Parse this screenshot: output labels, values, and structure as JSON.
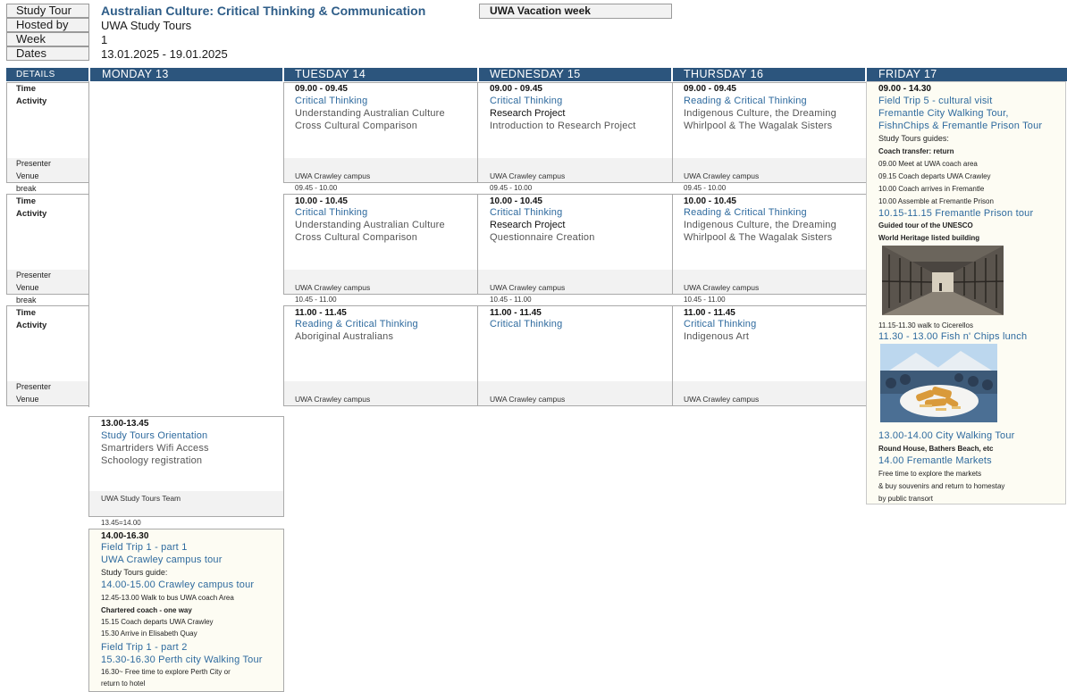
{
  "header": {
    "labels": [
      "Study Tour",
      "Hosted by",
      "Week",
      "Dates"
    ],
    "course_title": "Australian Culture: Critical Thinking & Communication",
    "hosted_by": "UWA Study Tours",
    "week": "1",
    "dates": "13.01.2025 - 19.01.2025",
    "vacation": "UWA Vacation week"
  },
  "days": [
    "DETAILS",
    "MONDAY 13",
    "TUESDAY 14",
    "WEDNESDAY 15",
    "THURSDAY 16",
    "FRIDAY 17"
  ],
  "details": {
    "time": "Time",
    "activity": "Activity",
    "presenter": "Presenter",
    "venue": "Venue",
    "break": "break"
  },
  "sessions": {
    "s1": {
      "tue": {
        "time": "09.00 - 09.45",
        "title": "Critical Thinking",
        "l1": "Understanding Australian Culture",
        "l2": "Cross Cultural Comparison",
        "venue": "UWA Crawley campus",
        "break": "09.45 - 10.00"
      },
      "wed": {
        "time": "09.00 - 09.45",
        "title": "Critical Thinking",
        "l1": "Research Project",
        "l2": "Introduction to Research Project",
        "venue": "UWA Crawley campus",
        "break": "09.45 - 10.00"
      },
      "thu": {
        "time": "09.00 - 09.45",
        "title": "Reading & Critical Thinking",
        "l1": "Indigenous Culture, the Dreaming",
        "l2": "Whirlpool & The Wagalak Sisters",
        "venue": "UWA Crawley campus",
        "break": "09.45 - 10.00"
      }
    },
    "s2": {
      "tue": {
        "time": "10.00 - 10.45",
        "title": "Critical Thinking",
        "l1": "Understanding Australian Culture",
        "l2": "Cross Cultural Comparison",
        "venue": "UWA Crawley campus",
        "break": "10.45 - 11.00"
      },
      "wed": {
        "time": "10.00 - 10.45",
        "title": "Critical Thinking",
        "l1": "Research Project",
        "l2": "Questionnaire Creation",
        "venue": "UWA Crawley campus",
        "break": "10.45 - 11.00"
      },
      "thu": {
        "time": "10.00 - 10.45",
        "title": "Reading & Critical Thinking",
        "l1": "Indigenous Culture, the Dreaming",
        "l2": "Whirlpool & The Wagalak Sisters",
        "venue": "UWA Crawley campus",
        "break": "10.45 - 11.00"
      }
    },
    "s3": {
      "tue": {
        "time": "11.00 - 11.45",
        "title": "Reading & Critical Thinking",
        "l1": "Aboriginal Australians",
        "venue": "UWA Crawley campus"
      },
      "wed": {
        "time": "11.00 - 11.45",
        "title": "Critical Thinking",
        "venue": "UWA Crawley campus"
      },
      "thu": {
        "time": "11.00 - 11.45",
        "title": "Critical Thinking",
        "l1": "Indigenous Art",
        "venue": "UWA Crawley campus"
      }
    }
  },
  "monday": {
    "orientation": {
      "time": "13.00-13.45",
      "title": "Study Tours Orientation",
      "l1": "Smartriders Wifi Access",
      "l2": "Schoology registration",
      "presenter": "UWA Study Tours Team",
      "break": "13.45=14.00"
    },
    "trip": {
      "time": "14.00-16.30",
      "t1": "Field Trip 1 - part 1",
      "t2": "UWA Crawley campus tour",
      "guide": "Study Tours guide:",
      "t3": "14.00-15.00 Crawley campus tour",
      "s1": "12.45-13.00  Walk to bus UWA coach Area",
      "coach": "Chartered coach - one way",
      "s2": "15.15  Coach departs UWA Crawley",
      "s3": "15.30  Arrive in Elisabeth Quay",
      "t4": "Field Trip 1 - part 2",
      "t5": "15.30-16.30 Perth city Walking Tour",
      "s4": "16.30~ Free time to explore Perth City or",
      "s5": "return to hotel"
    }
  },
  "friday": {
    "time": "09.00 - 14.30",
    "t1": "Field Trip 5 - cultural visit",
    "t2": "Fremantle City Walking Tour,",
    "t3": "FishnChips & Fremantle Prison Tour",
    "guides": "Study Tours guides:",
    "coach": "Coach transfer: return",
    "s1": "09.00  Meet at UWA coach area",
    "s2": "09.15  Coach departs UWA Crawley",
    "s3": "10.00 Coach arrives in Fremantle",
    "s4": "10.00 Assemble at Fremantle Prison",
    "t4": "10.15-11.15 Fremantle Prison tour",
    "b1": "Guided tour of the UNESCO",
    "b2": "World Heritage listed building",
    "s5": "11.15-11.30 walk to Cicerellos",
    "t5": "11.30 - 13.00 Fish n' Chips lunch",
    "t6": "13.00-14.00  City Walking Tour",
    "b3": "Round House, Bathers Beach, etc",
    "t7": "14.00  Fremantle Markets",
    "s6": "Free time to explore the markets",
    "s7": "& buy souvenirs and return to homestay",
    "s8": "by public transort"
  },
  "colors": {
    "header_bar": "#2c557d",
    "title_blue": "#2e6a9e",
    "friday_bg": "#fdfcf3"
  },
  "images": [
    "prison-corridor-photo",
    "fish-and-chips-photo"
  ]
}
